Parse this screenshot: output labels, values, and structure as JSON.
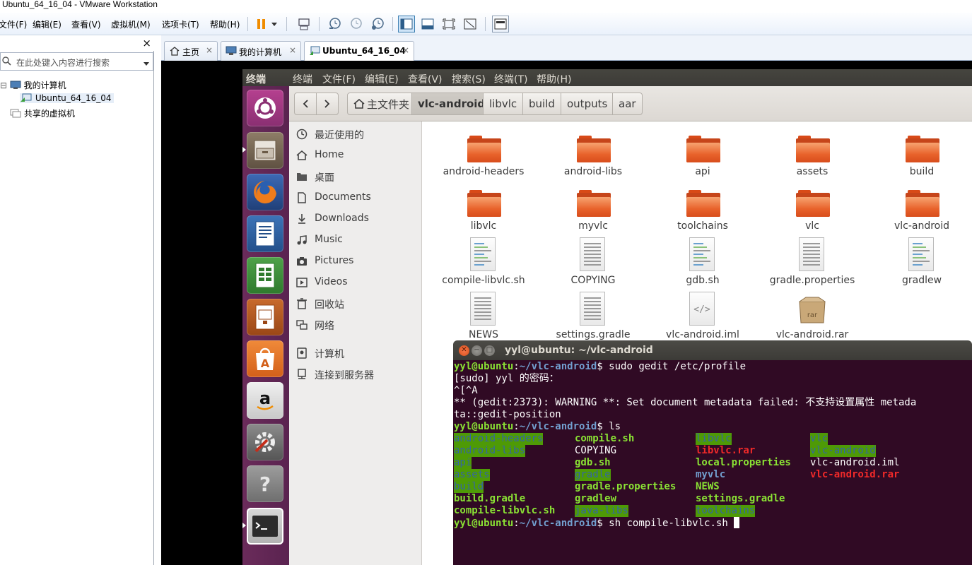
{
  "window": {
    "title": "Ubuntu_64_16_04 - VMware Workstation"
  },
  "vmware": {
    "menu": [
      "文件(F)",
      "编辑(E)",
      "查看(V)",
      "虚拟机(M)",
      "选项卡(T)",
      "帮助(H)"
    ],
    "library": {
      "close": "×",
      "search_placeholder": "在此处键入内容进行搜索",
      "tree": {
        "my_computer": "我的计算机",
        "vm": "Ubuntu_64_16_04",
        "shared": "共享的虚拟机"
      }
    },
    "tabs": [
      {
        "label": "主页",
        "icon": "home-icon"
      },
      {
        "label": "我的计算机",
        "icon": "computer-icon"
      },
      {
        "label": "Ubuntu_64_16_04",
        "icon": "vm-icon",
        "active": true
      }
    ],
    "tab_close": "×"
  },
  "ubuntu": {
    "topbar": {
      "app": "终端",
      "menus": [
        "终端",
        "文件(F)",
        "编辑(E)",
        "查看(V)",
        "搜索(S)",
        "终端(T)",
        "帮助(H)"
      ]
    },
    "launcher": [
      "ubuntu-dash-icon",
      "files-icon",
      "firefox-icon",
      "writer-icon",
      "calc-icon",
      "impress-icon",
      "software-center-icon",
      "amazon-icon",
      "system-settings-icon",
      "help-icon",
      "terminal-icon"
    ]
  },
  "nautilus": {
    "back": "<",
    "forward": ">",
    "breadcrumbs": [
      "主文件夹",
      "vlc-android",
      "libvlc",
      "build",
      "outputs",
      "aar"
    ],
    "active_crumb": "vlc-android",
    "sidebar": [
      {
        "label": "最近使用的",
        "icon": "clock-icon"
      },
      {
        "label": "Home",
        "icon": "home-icon"
      },
      {
        "label": "桌面",
        "icon": "folder-icon"
      },
      {
        "label": "Documents",
        "icon": "document-icon"
      },
      {
        "label": "Downloads",
        "icon": "download-icon"
      },
      {
        "label": "Music",
        "icon": "music-icon"
      },
      {
        "label": "Pictures",
        "icon": "camera-icon"
      },
      {
        "label": "Videos",
        "icon": "video-icon"
      },
      {
        "label": "回收站",
        "icon": "trash-icon"
      },
      {
        "label": "网络",
        "icon": "network-icon"
      },
      {
        "label": "计算机",
        "icon": "drive-icon"
      },
      {
        "label": "连接到服务器",
        "icon": "server-icon"
      }
    ],
    "files": [
      {
        "name": "android-headers",
        "kind": "folder"
      },
      {
        "name": "android-libs",
        "kind": "folder"
      },
      {
        "name": "api",
        "kind": "folder"
      },
      {
        "name": "assets",
        "kind": "folder"
      },
      {
        "name": "build",
        "kind": "folder"
      },
      {
        "name": "libvlc",
        "kind": "folder"
      },
      {
        "name": "myvlc",
        "kind": "folder"
      },
      {
        "name": "toolchains",
        "kind": "folder"
      },
      {
        "name": "vlc",
        "kind": "folder"
      },
      {
        "name": "vlc-android",
        "kind": "folder"
      },
      {
        "name": "compile-libvlc.sh",
        "kind": "script"
      },
      {
        "name": "COPYING",
        "kind": "text"
      },
      {
        "name": "gdb.sh",
        "kind": "script"
      },
      {
        "name": "gradle.properties",
        "kind": "text"
      },
      {
        "name": "gradlew",
        "kind": "script"
      },
      {
        "name": "NEWS",
        "kind": "text"
      },
      {
        "name": "settings.gradle",
        "kind": "text"
      },
      {
        "name": "vlc-android.iml",
        "kind": "xml"
      },
      {
        "name": "vlc-android.rar",
        "kind": "archive"
      }
    ]
  },
  "terminal": {
    "title": "yyl@ubuntu: ~/vlc-android",
    "prompt_user": "yyl@ubuntu",
    "prompt_path": "~/vlc-android",
    "cmd1": " sudo gedit /etc/profile",
    "sudo_line": "[sudo] yyl 的密码：",
    "ctrl_line": "^[^A",
    "warn_line1": "** (gedit:2373): WARNING **: Set document metadata failed: 不支持设置属性 metada",
    "warn_line2": "ta::gedit-position",
    "cmd2": " ls",
    "cmd3": " sh compile-libvlc.sh ",
    "ls": {
      "c1": [
        "android-headers",
        "android-libs",
        "api",
        "assets",
        "build",
        "build.gradle",
        "compile-libvlc.sh"
      ],
      "c2": [
        "compile.sh",
        "COPYING",
        "gdb.sh",
        "gradle",
        "gradle.properties",
        "gradlew",
        "java-libs"
      ],
      "c3": [
        "libvlc",
        "libvlc.rar",
        "local.properties",
        "myvlc",
        "NEWS",
        "settings.gradle",
        "toolchains"
      ],
      "c4": [
        "vlc",
        "vlc-android",
        "vlc-android.iml",
        "vlc-android.rar"
      ]
    }
  }
}
